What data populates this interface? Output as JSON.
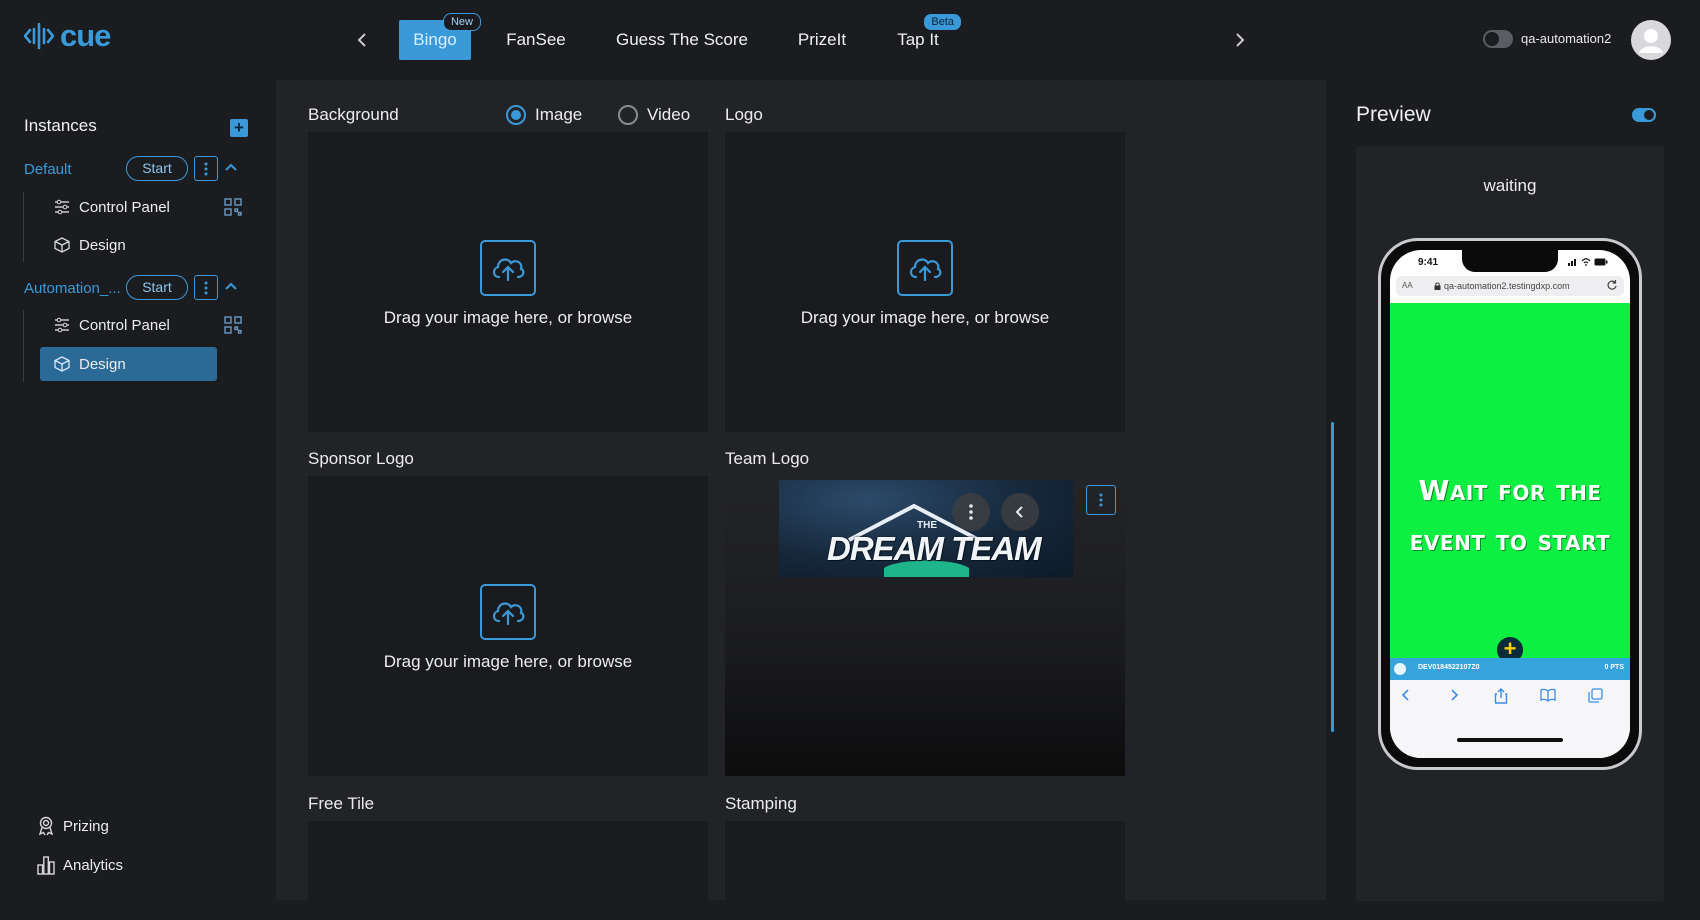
{
  "header": {
    "logo_text": "cue",
    "tabs": [
      {
        "label": "Bingo",
        "badge": "New",
        "active": true
      },
      {
        "label": "FanSee",
        "badge": ""
      },
      {
        "label": "Guess The Score",
        "badge": ""
      },
      {
        "label": "PrizeIt",
        "badge": ""
      },
      {
        "label": "Tap It",
        "badge": "Beta"
      }
    ],
    "username": "qa-automation2"
  },
  "sidebar": {
    "title": "Instances",
    "instances": [
      {
        "name": "Default",
        "start_label": "Start",
        "items": [
          {
            "label": "Control Panel"
          },
          {
            "label": "Design"
          }
        ]
      },
      {
        "name": "Automation_...",
        "start_label": "Start",
        "items": [
          {
            "label": "Control Panel"
          },
          {
            "label": "Design",
            "active": true
          }
        ]
      }
    ],
    "bottom": [
      {
        "label": "Prizing"
      },
      {
        "label": "Analytics"
      }
    ]
  },
  "editor": {
    "background_label": "Background",
    "background_type": {
      "options": [
        "Image",
        "Video"
      ],
      "selected": "Image"
    },
    "logo_label": "Logo",
    "sponsor_logo_label": "Sponsor Logo",
    "team_logo_label": "Team Logo",
    "free_tile_label": "Free Tile",
    "stamping_label": "Stamping",
    "dropzone_text": "Drag your image here, or browse",
    "team_image_small": "THE",
    "team_image_title": "DREAM TEAM"
  },
  "preview": {
    "title": "Preview",
    "status": "waiting",
    "phone": {
      "time": "9:41",
      "url_aa": "AA",
      "url": "qa-automation2.testingdxp.com",
      "message_line1": "Wait for the",
      "message_line2": "event to start",
      "user_id": "DEV0184522107Z0",
      "points": "0 PTS"
    }
  },
  "colors": {
    "accent": "#3a9ad9",
    "background": "#1b1c20",
    "phone_green": "#0ef041"
  }
}
